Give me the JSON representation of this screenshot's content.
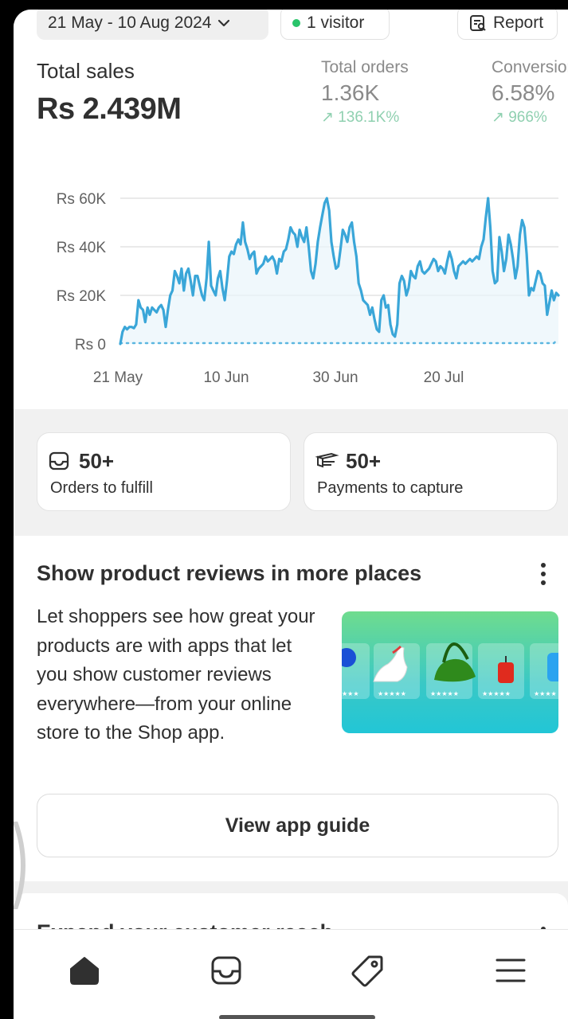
{
  "filters": {
    "date_range": "21 May - 10 Aug 2024",
    "visitors": "1 visitor",
    "report_label": "Report"
  },
  "metrics": {
    "total_sales": {
      "label": "Total sales",
      "value": "Rs 2.439M"
    },
    "total_orders": {
      "label": "Total orders",
      "value": "1.36K",
      "delta": "136.1K%"
    },
    "conversion": {
      "label": "Conversion",
      "value": "6.58%",
      "delta": "966%"
    }
  },
  "chart_data": {
    "type": "line",
    "y_ticks": [
      "Rs 60K",
      "Rs 40K",
      "Rs 20K",
      "Rs 0"
    ],
    "x_ticks": [
      "21 May",
      "10 Jun",
      "30 Jun",
      "20 Jul"
    ],
    "ylim": [
      0,
      60000
    ],
    "series": [
      {
        "values": [
          0,
          5000,
          7000,
          6000,
          7000,
          7000,
          6500,
          8000,
          18000,
          15000,
          14000,
          9000,
          15000,
          12000,
          15000,
          14000,
          13000,
          15000,
          16000,
          14000,
          7000,
          14000,
          20000,
          22000,
          30000,
          28000,
          25000,
          31000,
          22000,
          29000,
          31000,
          26000,
          20000,
          28000,
          28000,
          24000,
          20000,
          18000,
          27000,
          42000,
          24000,
          22000,
          20000,
          27000,
          30000,
          23000,
          18000,
          26000,
          36000,
          38000,
          37000,
          41000,
          43000,
          41000,
          50000,
          42000,
          39000,
          35000,
          37000,
          38000,
          29000,
          31000,
          32000,
          33000,
          36000,
          34000,
          35000,
          36000,
          34000,
          29000,
          35000,
          34000,
          38000,
          39000,
          43000,
          48000,
          46000,
          45000,
          40000,
          47000,
          44000,
          42000,
          48000,
          40000,
          30000,
          27000,
          33000,
          42000,
          48000,
          53000,
          58000,
          60000,
          55000,
          42000,
          36000,
          31000,
          32000,
          39000,
          47000,
          45000,
          42000,
          48000,
          50000,
          42000,
          36000,
          25000,
          22000,
          18000,
          17000,
          16000,
          12000,
          15000,
          10000,
          6000,
          5000,
          18000,
          20000,
          15000,
          16000,
          8000,
          4000,
          3000,
          8000,
          25000,
          28000,
          26000,
          20000,
          23000,
          30000,
          28000,
          27000,
          32000,
          34000,
          30000,
          29000,
          30000,
          31000,
          33000,
          35000,
          34000,
          30000,
          32000,
          31000,
          29000,
          34000,
          38000,
          35000,
          30000,
          27000,
          32000,
          33000,
          34000,
          33000,
          34000,
          35000,
          34000,
          35000,
          36000,
          35000,
          40000,
          43000,
          52000,
          60000,
          48000,
          30000,
          25000,
          26000,
          44000,
          38000,
          30000,
          35000,
          45000,
          41000,
          35000,
          27000,
          32000,
          45000,
          51000,
          48000,
          37000,
          20000,
          23000,
          22000,
          26000,
          30000,
          29000,
          25000,
          24000,
          12000,
          17000,
          22000,
          18000,
          21000,
          20000
        ]
      },
      {
        "values": [
          0,
          0,
          0,
          0,
          0,
          0,
          0,
          0,
          0,
          0,
          0,
          0,
          0,
          0,
          0,
          0,
          0,
          0,
          0,
          0,
          0,
          0,
          0,
          0,
          0,
          0,
          0,
          0,
          0,
          0,
          0,
          0,
          0,
          0,
          0,
          0,
          0,
          0,
          0,
          0,
          0,
          0,
          0,
          0,
          0,
          0,
          0,
          0,
          0,
          0,
          0,
          0,
          0,
          0,
          0,
          0,
          0,
          0,
          0,
          0,
          0,
          0,
          0,
          0,
          0,
          0,
          0,
          0,
          0,
          0,
          0,
          0,
          0,
          0,
          0,
          0,
          0,
          0,
          0,
          0,
          0,
          0,
          0,
          0,
          0,
          0,
          0,
          0,
          0,
          0,
          0,
          0,
          0,
          0,
          0,
          0,
          0,
          0,
          0,
          0,
          0,
          0,
          0,
          0,
          0,
          0,
          0,
          0,
          0,
          0,
          0,
          0,
          0,
          0,
          0,
          0,
          0,
          0,
          0,
          0,
          0,
          0,
          0,
          0,
          0,
          0,
          0,
          0,
          0,
          0,
          0,
          0,
          0,
          0,
          0,
          0,
          0,
          0,
          0,
          0,
          0,
          0,
          0,
          0,
          0,
          0,
          0,
          0,
          0,
          0,
          0,
          0,
          0,
          0,
          0,
          0,
          0,
          0,
          0,
          0,
          0,
          0,
          0,
          0,
          0,
          0,
          0,
          0,
          0,
          0,
          0,
          0,
          0,
          0,
          0,
          0,
          0,
          0,
          0,
          0,
          0,
          0,
          0,
          0,
          0,
          0,
          0,
          0,
          0,
          0,
          0,
          0,
          0,
          0,
          0,
          0,
          0,
          0,
          0,
          1000,
          1000
        ]
      }
    ]
  },
  "quick_cards": [
    {
      "count": "50+",
      "label": "Orders to fulfill",
      "icon": "inbox-icon"
    },
    {
      "count": "50+",
      "label": "Payments to capture",
      "icon": "payments-icon"
    }
  ],
  "reviews_card": {
    "title": "Show product reviews in more places",
    "body": "Let shoppers see how great your products are with apps that let you show customer reviews everywhere—from your online store to the Shop app.",
    "button": "View app guide"
  },
  "next_card": {
    "title": "Expand your customer reach"
  },
  "nav": [
    {
      "name": "home",
      "icon": "home-icon",
      "active": true
    },
    {
      "name": "orders",
      "icon": "inbox-icon",
      "active": false
    },
    {
      "name": "products",
      "icon": "tag-icon",
      "active": false
    },
    {
      "name": "menu",
      "icon": "hamburger-menu-icon",
      "active": false
    }
  ],
  "colors": {
    "accent_line": "#3aa6d8",
    "positive_delta": "#8fd0b0",
    "status_dot": "#29c46a"
  }
}
